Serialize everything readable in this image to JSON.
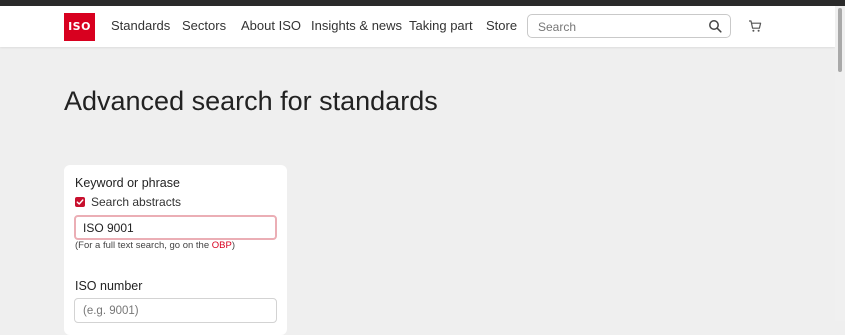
{
  "header": {
    "logo_text": "ISO",
    "nav": [
      "Standards",
      "Sectors",
      "About ISO",
      "Insights & news",
      "Taking part",
      "Store"
    ],
    "search_placeholder": "Search"
  },
  "page": {
    "title": "Advanced search for standards"
  },
  "form": {
    "keyword_label": "Keyword or phrase",
    "search_abstracts_label": "Search abstracts",
    "search_abstracts_checked": true,
    "keyword_value": "ISO 9001",
    "hint_prefix": "(For a full text search, go on the ",
    "hint_link": "OBP",
    "hint_suffix": ")",
    "iso_number_label": "ISO number",
    "iso_number_placeholder": "(e.g. 9001)"
  },
  "colors": {
    "accent": "#d8001f",
    "checkbox": "#c8102e"
  }
}
